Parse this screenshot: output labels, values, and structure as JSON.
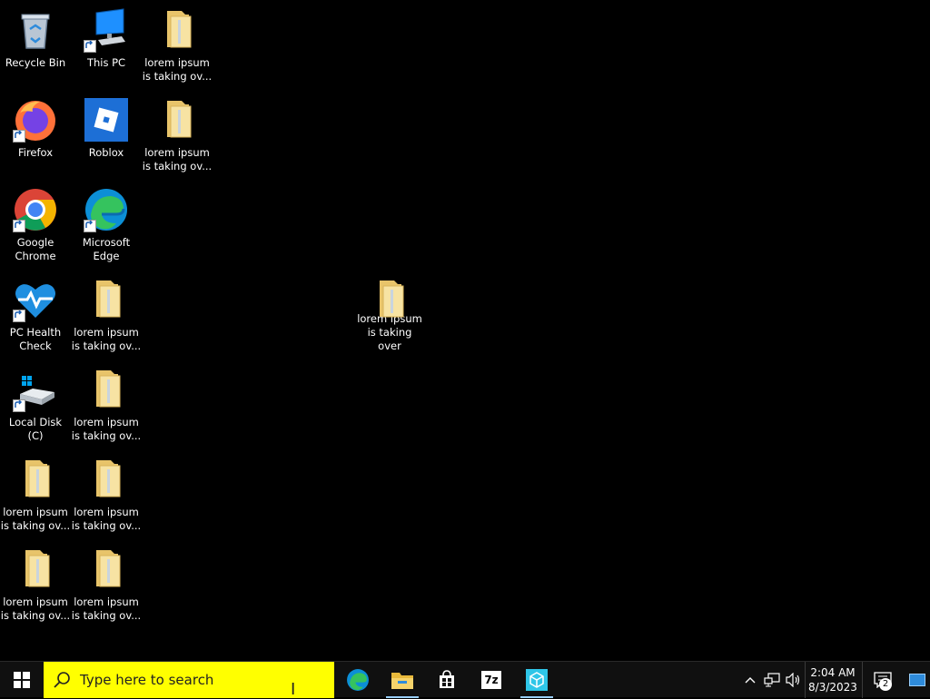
{
  "desktop": {
    "icons": [
      {
        "label": "Recycle Bin",
        "icon": "recycle-bin-icon"
      },
      {
        "label": "This PC",
        "icon": "this-pc-icon"
      },
      {
        "label": "lorem ipsum is taking ov...",
        "icon": "folder-icon"
      },
      {
        "label": "Firefox",
        "icon": "firefox-icon"
      },
      {
        "label": "Roblox",
        "icon": "roblox-icon"
      },
      {
        "label": "lorem ipsum is taking ov...",
        "icon": "folder-icon"
      },
      {
        "label": "Google Chrome",
        "icon": "chrome-icon"
      },
      {
        "label": "Microsoft Edge",
        "icon": "edge-icon"
      },
      {
        "label": "PC Health Check",
        "icon": "pc-health-check-icon"
      },
      {
        "label": "lorem ipsum is taking ov...",
        "icon": "folder-icon"
      },
      {
        "label": "lorem ipsum is taking over",
        "icon": "folder-icon"
      },
      {
        "label": "Local Disk (C)",
        "icon": "local-disk-icon"
      },
      {
        "label": "lorem ipsum is taking ov...",
        "icon": "folder-icon"
      },
      {
        "label": "lorem ipsum is taking ov...",
        "icon": "folder-icon"
      },
      {
        "label": "lorem ipsum is taking ov...",
        "icon": "folder-icon"
      },
      {
        "label": "lorem ipsum is taking ov...",
        "icon": "folder-icon"
      },
      {
        "label": "lorem ipsum is taking ov...",
        "icon": "folder-icon"
      }
    ]
  },
  "taskbar": {
    "search_placeholder": "Type here to search",
    "search_bg": "#ffff00",
    "apps": [
      {
        "name": "Microsoft Edge",
        "icon": "edge-icon",
        "open": false
      },
      {
        "name": "File Explorer",
        "icon": "file-explorer-icon",
        "open": true
      },
      {
        "name": "Microsoft Store",
        "icon": "store-icon",
        "open": false
      },
      {
        "name": "7-Zip",
        "icon": "7zip-icon",
        "label": "7z",
        "open": false
      },
      {
        "name": "App",
        "icon": "cube-app-icon",
        "open": true
      }
    ],
    "time": "2:04 AM",
    "date": "8/3/2023",
    "notification_count": "2"
  }
}
